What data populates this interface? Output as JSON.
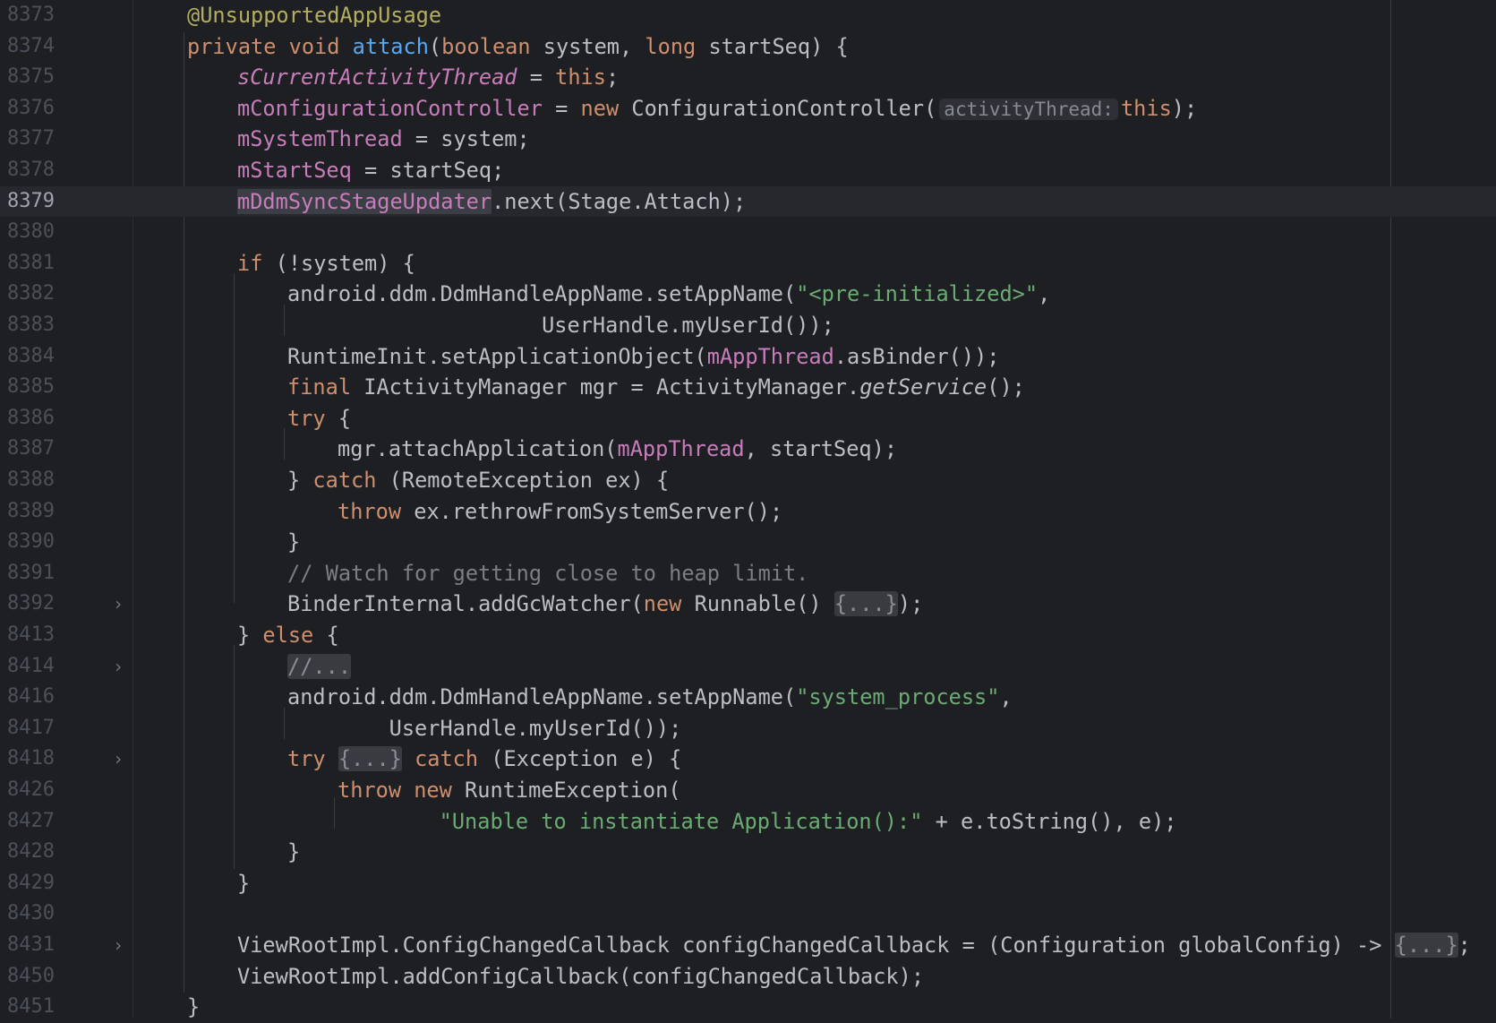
{
  "editor": {
    "current_line": "8379",
    "lines": [
      {
        "n": "8373",
        "i": 0,
        "t": [
          [
            "ann",
            "@UnsupportedAppUsage"
          ]
        ]
      },
      {
        "n": "8374",
        "i": 0,
        "t": [
          [
            "kw",
            "private void "
          ],
          [
            "fn",
            "attach"
          ],
          [
            "",
            "("
          ],
          [
            "kw",
            "boolean "
          ],
          [
            "",
            "system, "
          ],
          [
            "kw",
            "long "
          ],
          [
            "",
            "startSeq) {"
          ]
        ]
      },
      {
        "n": "8375",
        "i": 1,
        "t": [
          [
            "sfld",
            "sCurrentActivityThread"
          ],
          [
            "",
            " = "
          ],
          [
            "kw",
            "this"
          ],
          [
            "",
            ";"
          ]
        ]
      },
      {
        "n": "8376",
        "i": 1,
        "t": [
          [
            "fld",
            "mConfigurationController"
          ],
          [
            "",
            " = "
          ],
          [
            "kw",
            "new "
          ],
          [
            "",
            "ConfigurationController("
          ],
          [
            "hint",
            "activityThread:"
          ],
          [
            "kw",
            "this"
          ],
          [
            "",
            ");"
          ]
        ]
      },
      {
        "n": "8377",
        "i": 1,
        "t": [
          [
            "fld",
            "mSystemThread"
          ],
          [
            "",
            " = system;"
          ]
        ]
      },
      {
        "n": "8378",
        "i": 1,
        "t": [
          [
            "fld",
            "mStartSeq"
          ],
          [
            "",
            " = startSeq;"
          ]
        ]
      },
      {
        "n": "8379",
        "i": 1,
        "t": [
          [
            "fld hl",
            "mDdmSyncStageUpdater"
          ],
          [
            "",
            ".next(Stage.Attach);"
          ]
        ]
      },
      {
        "n": "8380",
        "i": 0,
        "t": []
      },
      {
        "n": "8381",
        "i": 1,
        "t": [
          [
            "kw",
            "if "
          ],
          [
            "",
            "(!system) {"
          ]
        ]
      },
      {
        "n": "8382",
        "i": 2,
        "t": [
          [
            "",
            "android.ddm.DdmHandleAppName.setAppName("
          ],
          [
            "str",
            "\"<pre-initialized>\""
          ],
          [
            "",
            ","
          ]
        ]
      },
      {
        "n": "8383",
        "i": 2,
        "t": [
          [
            "",
            "                    UserHandle.myUserId());"
          ]
        ]
      },
      {
        "n": "8384",
        "i": 2,
        "t": [
          [
            "",
            "RuntimeInit.setApplicationObject("
          ],
          [
            "fld",
            "mAppThread"
          ],
          [
            "",
            ".asBinder());"
          ]
        ]
      },
      {
        "n": "8385",
        "i": 2,
        "t": [
          [
            "kw",
            "final "
          ],
          [
            "",
            "IActivityManager mgr = ActivityManager."
          ],
          [
            "it",
            "getService"
          ],
          [
            "",
            "();"
          ]
        ]
      },
      {
        "n": "8386",
        "i": 2,
        "t": [
          [
            "kw",
            "try "
          ],
          [
            "",
            "{"
          ]
        ]
      },
      {
        "n": "8387",
        "i": 3,
        "t": [
          [
            "",
            "mgr.attachApplication("
          ],
          [
            "fld",
            "mAppThread"
          ],
          [
            "",
            ", startSeq);"
          ]
        ]
      },
      {
        "n": "8388",
        "i": 2,
        "t": [
          [
            "",
            "} "
          ],
          [
            "kw",
            "catch "
          ],
          [
            "",
            "(RemoteException ex) {"
          ]
        ]
      },
      {
        "n": "8389",
        "i": 3,
        "t": [
          [
            "kw",
            "throw "
          ],
          [
            "",
            "ex.rethrowFromSystemServer();"
          ]
        ]
      },
      {
        "n": "8390",
        "i": 2,
        "t": [
          [
            "",
            "}"
          ]
        ]
      },
      {
        "n": "8391",
        "i": 2,
        "t": [
          [
            "cmt",
            "// Watch for getting close to heap limit."
          ]
        ]
      },
      {
        "n": "8392",
        "i": 2,
        "fold": true,
        "t": [
          [
            "",
            "BinderInternal.addGcWatcher("
          ],
          [
            "kw",
            "new "
          ],
          [
            "",
            "Runnable() "
          ],
          [
            "folded",
            "{...}"
          ],
          [
            "",
            ");"
          ]
        ]
      },
      {
        "n": "8413",
        "i": 1,
        "t": [
          [
            "",
            "} "
          ],
          [
            "kw",
            "else "
          ],
          [
            "",
            "{"
          ]
        ]
      },
      {
        "n": "8414",
        "i": 2,
        "fold": true,
        "t": [
          [
            "cmt folded",
            "//..."
          ]
        ]
      },
      {
        "n": "8416",
        "i": 2,
        "t": [
          [
            "",
            "android.ddm.DdmHandleAppName.setAppName("
          ],
          [
            "str",
            "\"system_process\""
          ],
          [
            "",
            ","
          ]
        ]
      },
      {
        "n": "8417",
        "i": 2,
        "t": [
          [
            "",
            "        UserHandle.myUserId());"
          ]
        ]
      },
      {
        "n": "8418",
        "i": 2,
        "fold": true,
        "t": [
          [
            "kw",
            "try "
          ],
          [
            "folded",
            "{...}"
          ],
          [
            "kw",
            " catch "
          ],
          [
            "",
            "(Exception e) {"
          ]
        ]
      },
      {
        "n": "8426",
        "i": 3,
        "t": [
          [
            "kw",
            "throw new "
          ],
          [
            "",
            "RuntimeException("
          ]
        ]
      },
      {
        "n": "8427",
        "i": 3,
        "t": [
          [
            "",
            "        "
          ],
          [
            "str",
            "\"Unable to instantiate Application():\""
          ],
          [
            "",
            " + e.toString(), e);"
          ]
        ]
      },
      {
        "n": "8428",
        "i": 2,
        "t": [
          [
            "",
            "}"
          ]
        ]
      },
      {
        "n": "8429",
        "i": 1,
        "t": [
          [
            "",
            "}"
          ]
        ]
      },
      {
        "n": "8430",
        "i": 0,
        "t": []
      },
      {
        "n": "8431",
        "i": 1,
        "fold": true,
        "t": [
          [
            "",
            "ViewRootImpl.ConfigChangedCallback configChangedCallback = (Configuration globalConfig) -> "
          ],
          [
            "folded",
            "{...}"
          ],
          [
            "",
            ";"
          ]
        ]
      },
      {
        "n": "8450",
        "i": 1,
        "t": [
          [
            "",
            "ViewRootImpl.addConfigCallback(configChangedCallback);"
          ]
        ]
      },
      {
        "n": "8451",
        "i": 0,
        "t": [
          [
            "",
            "}"
          ]
        ]
      }
    ]
  }
}
